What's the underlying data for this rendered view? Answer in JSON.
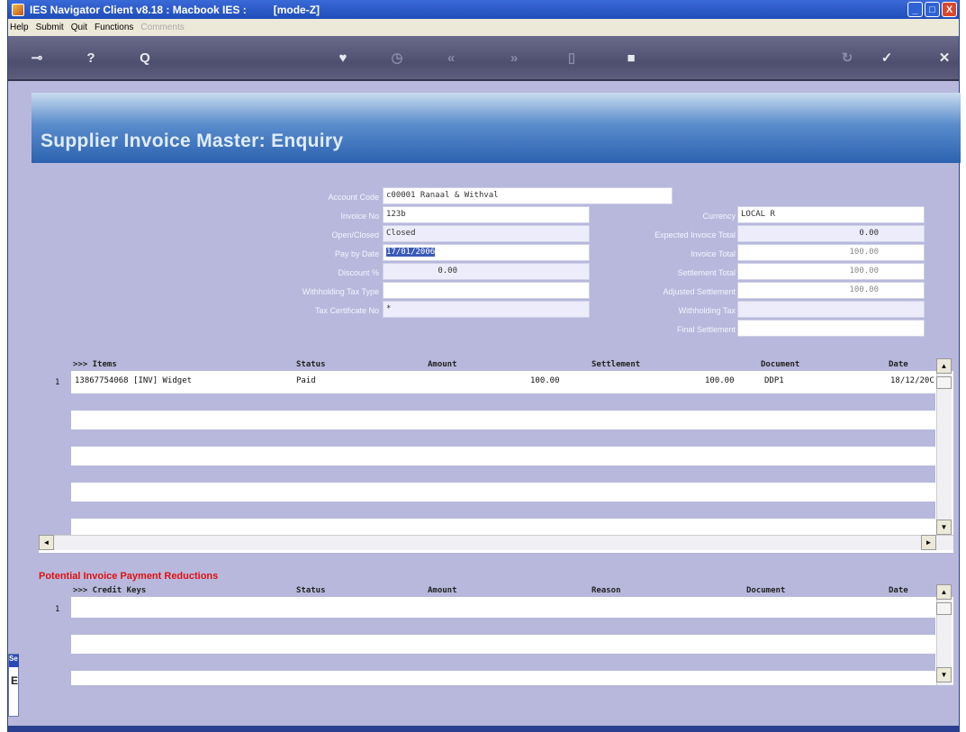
{
  "window": {
    "title": "IES Navigator Client v8.18 : Macbook IES :",
    "mode": "[mode-Z]",
    "buttons": [
      "_",
      "□",
      "X"
    ]
  },
  "menu": {
    "items": [
      "Help",
      "Submit",
      "Quit",
      "Functions"
    ],
    "disabled": "Comments"
  },
  "toolbar": {
    "icons": [
      "key-icon",
      "help-icon",
      "search-icon",
      "heart-icon",
      "clock-icon",
      "rewind-icon",
      "forward-icon",
      "bookmark-icon",
      "stop-icon",
      "refresh-icon",
      "ok-icon",
      "cancel-icon"
    ],
    "glyphs": {
      "key": "⊸",
      "help": "?",
      "search": "Q",
      "heart": "♥",
      "clock": "◷",
      "rewind": "«",
      "forward": "»",
      "bookmark": "▯",
      "stop": "■",
      "refresh": "↻",
      "ok": "✓",
      "cancel": "✕"
    }
  },
  "header": {
    "title": "Supplier Invoice Master: Enquiry"
  },
  "form": {
    "left": [
      {
        "label": "Account Code",
        "value": "c00001 Ranaal & Withval"
      },
      {
        "label": "Invoice No",
        "value": "123b"
      },
      {
        "label": "Open/Closed",
        "value": "Closed"
      },
      {
        "label": "Pay by Date",
        "value": "17/01/2006"
      },
      {
        "label": "Discount %",
        "value": "0.00"
      },
      {
        "label": "Withholding Tax Type",
        "value": ""
      },
      {
        "label": "Tax Certificate No",
        "value": "*"
      }
    ],
    "right": [
      {
        "label": "Currency",
        "value": "LOCAL R"
      },
      {
        "label": "Expected Invoice Total",
        "value": "0.00"
      },
      {
        "label": "Invoice Total",
        "value": "100.00"
      },
      {
        "label": "Settlement Total",
        "value": "100.00"
      },
      {
        "label": "Adjusted Settlement",
        "value": "100.00"
      },
      {
        "label": "Withholding Tax",
        "value": ""
      },
      {
        "label": "Final Settlement",
        "value": ""
      }
    ]
  },
  "items_grid": {
    "columns": [
      ">>> Items",
      "Status",
      "Amount",
      "Settlement",
      "Document",
      "Date"
    ],
    "rows": [
      {
        "num": "1",
        "item": "13867754068 [INV] Widget",
        "status": "Paid",
        "amount": "100.00",
        "settlement": "100.00",
        "document": "DDP1",
        "date": "18/12/20C"
      }
    ]
  },
  "reductions": {
    "title": "Potential Invoice Payment Reductions",
    "columns": [
      ">>> Credit Keys",
      "Status",
      "Amount",
      "Reason",
      "Document",
      "Date"
    ],
    "rows": [
      {
        "num": "1"
      }
    ]
  },
  "side_tab": {
    "label": "Se",
    "letter": "E"
  },
  "scroll": {
    "up": "▲",
    "down": "▼",
    "left": "◄",
    "right": "►"
  }
}
